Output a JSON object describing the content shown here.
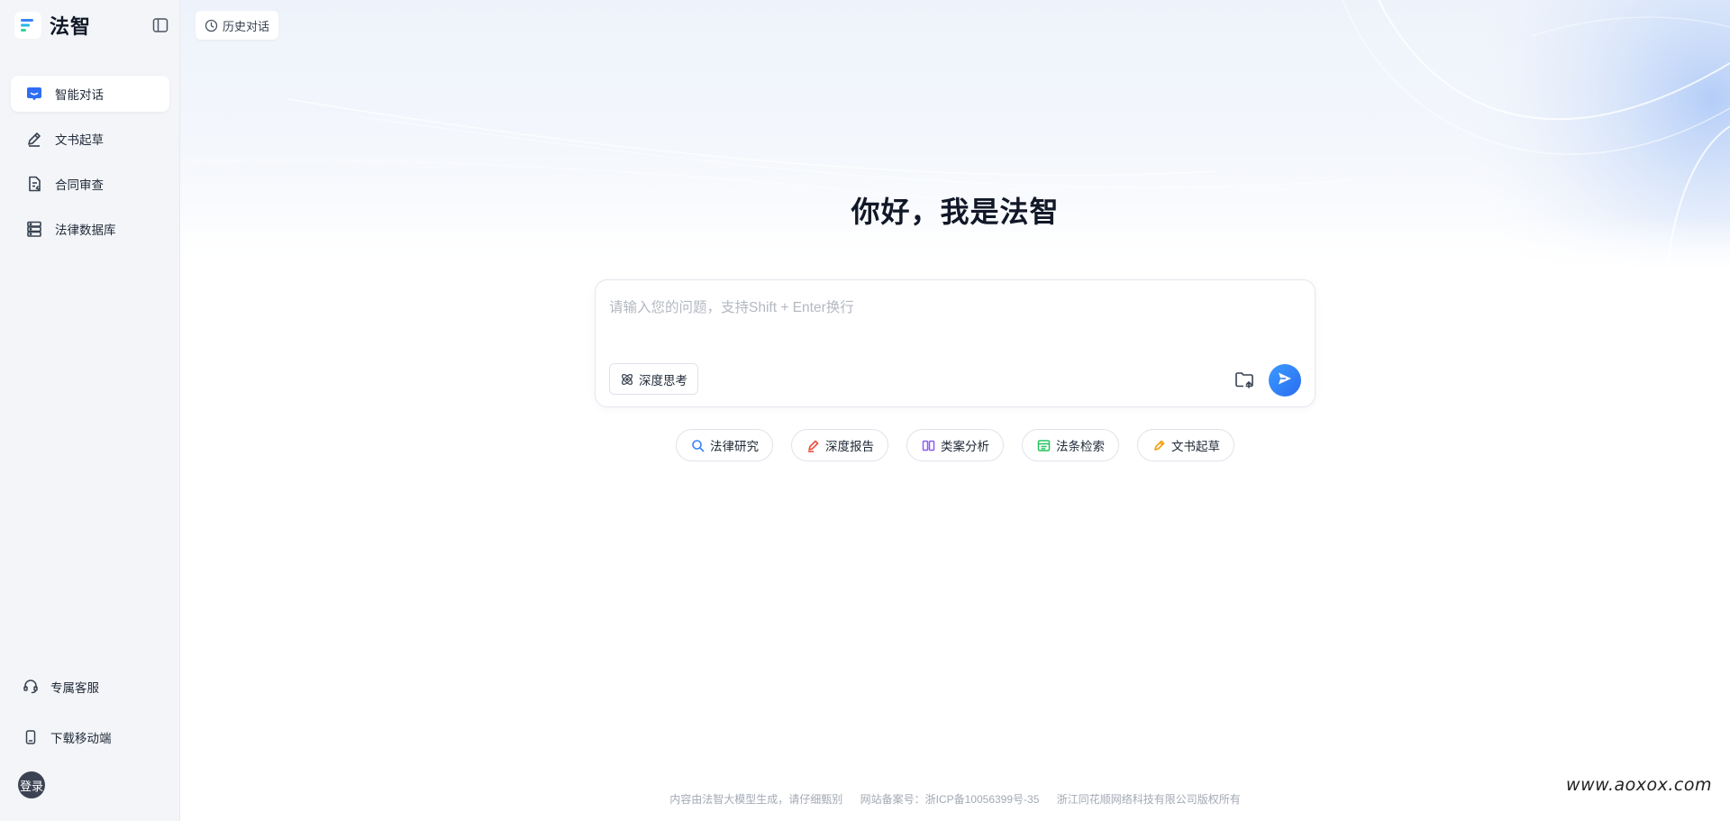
{
  "brand": {
    "name": "法智"
  },
  "header": {
    "history_label": "历史对话"
  },
  "sidebar": {
    "items": [
      {
        "label": "智能对话",
        "icon": "chat-bubble-icon",
        "active": true
      },
      {
        "label": "文书起草",
        "icon": "pen-icon",
        "active": false
      },
      {
        "label": "合同审查",
        "icon": "document-check-icon",
        "active": false
      },
      {
        "label": "法律数据库",
        "icon": "database-icon",
        "active": false
      }
    ],
    "bottom": [
      {
        "label": "专属客服",
        "icon": "headset-icon"
      },
      {
        "label": "下载移动端",
        "icon": "phone-icon"
      }
    ],
    "login_label": "登录"
  },
  "main": {
    "greeting": "你好，我是法智",
    "input": {
      "placeholder": "请输入您的问题，支持Shift + Enter换行",
      "value": ""
    },
    "deep_think_label": "深度思考",
    "chips": [
      {
        "label": "法律研究",
        "icon": "search-icon",
        "color": "#3b82f6"
      },
      {
        "label": "深度报告",
        "icon": "pencil-report-icon",
        "color": "#f04e3e"
      },
      {
        "label": "类案分析",
        "icon": "book-icon",
        "color": "#8b5cf6"
      },
      {
        "label": "法条检索",
        "icon": "list-table-icon",
        "color": "#22c55e"
      },
      {
        "label": "文书起草",
        "icon": "edit-icon",
        "color": "#f59e0b"
      }
    ]
  },
  "footer": {
    "disclaimer": "内容由法智大模型生成，请仔细甄别",
    "icp": "网站备案号：浙ICP备10056399号-35",
    "copyright": "浙江同花顺网络科技有限公司版权所有"
  },
  "watermark": "www.aoxox.com",
  "colors": {
    "accent": "#2a7cf6",
    "sidebar_bg": "#f3f5f8"
  }
}
